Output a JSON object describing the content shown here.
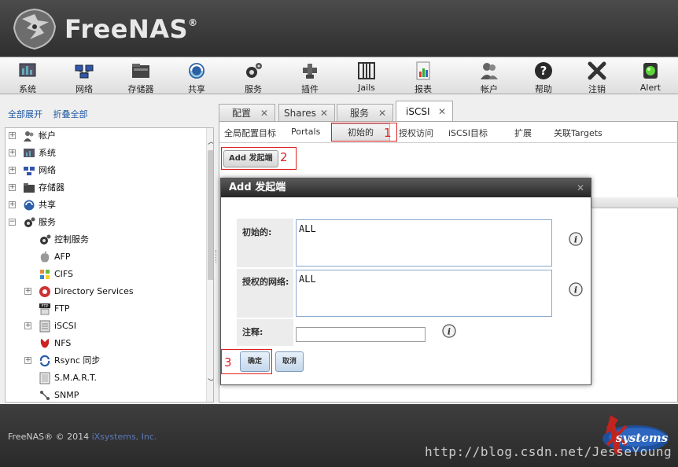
{
  "app": {
    "logo_text": "FreeNAS",
    "logo_reg": "®"
  },
  "toolbar": {
    "items": [
      {
        "label": "系统",
        "icon": "system-icon"
      },
      {
        "label": "网络",
        "icon": "network-icon"
      },
      {
        "label": "存储器",
        "icon": "storage-icon"
      },
      {
        "label": "共享",
        "icon": "sharing-icon"
      },
      {
        "label": "服务",
        "icon": "services-icon"
      },
      {
        "label": "插件",
        "icon": "plugins-icon"
      },
      {
        "label": "Jails",
        "icon": "jails-icon"
      },
      {
        "label": "报表",
        "icon": "reporting-icon"
      },
      {
        "label": "帐户",
        "icon": "account-icon"
      },
      {
        "label": "帮助",
        "icon": "help-icon"
      },
      {
        "label": "注销",
        "icon": "logout-icon"
      },
      {
        "label": "Alert",
        "icon": "alert-icon"
      }
    ]
  },
  "tree": {
    "expand_all": "全部展开",
    "collapse_all": "折叠全部",
    "items": [
      {
        "label": "帐户",
        "icon": "account-icon"
      },
      {
        "label": "系统",
        "icon": "system-icon"
      },
      {
        "label": "网络",
        "icon": "network-icon"
      },
      {
        "label": "存储器",
        "icon": "storage-icon"
      },
      {
        "label": "共享",
        "icon": "sharing-icon"
      },
      {
        "label": "服务",
        "icon": "services-icon"
      },
      {
        "label": "控制服务",
        "icon": "control-services-icon"
      },
      {
        "label": "AFP",
        "icon": "afp-icon"
      },
      {
        "label": "CIFS",
        "icon": "cifs-icon"
      },
      {
        "label": "Directory Services",
        "icon": "directory-services-icon"
      },
      {
        "label": "FTP",
        "icon": "ftp-icon"
      },
      {
        "label": "iSCSI",
        "icon": "iscsi-icon"
      },
      {
        "label": "NFS",
        "icon": "nfs-icon"
      },
      {
        "label": "Rsync 同步",
        "icon": "rsync-icon"
      },
      {
        "label": "S.M.A.R.T.",
        "icon": "smart-icon"
      },
      {
        "label": "SNMP",
        "icon": "snmp-icon"
      }
    ]
  },
  "main_tabs": [
    {
      "label": "配置"
    },
    {
      "label": "Shares"
    },
    {
      "label": "服务"
    },
    {
      "label": "iSCSI"
    }
  ],
  "sub_tabs": [
    {
      "label": "全局配置目标"
    },
    {
      "label": "Portals"
    },
    {
      "label": "初始的"
    },
    {
      "label": "授权访问"
    },
    {
      "label": "iSCSI目标"
    },
    {
      "label": "扩展"
    },
    {
      "label": "关联Targets"
    }
  ],
  "add_button_label": "Add 发起端",
  "modal": {
    "title": "Add 发起端",
    "fields": {
      "initiators_label": "初始的:",
      "initiators_value": "ALL",
      "auth_network_label": "授权的网络:",
      "auth_network_value": "ALL",
      "comment_label": "注释:",
      "comment_value": ""
    },
    "ok_label": "确定",
    "cancel_label": "取消"
  },
  "annotations": [
    "1",
    "2",
    "3"
  ],
  "footer": {
    "copyright_prefix": "FreeNAS® © 2014",
    "copyright_link": "iXsystems, Inc.",
    "ix_logo_text": "systems",
    "watermark": "http://blog.csdn.net/JesseYoung"
  },
  "colors": {
    "annotation_red": "#e02020",
    "link_blue": "#1d58a0",
    "header_dark": "#2f2f2f"
  }
}
